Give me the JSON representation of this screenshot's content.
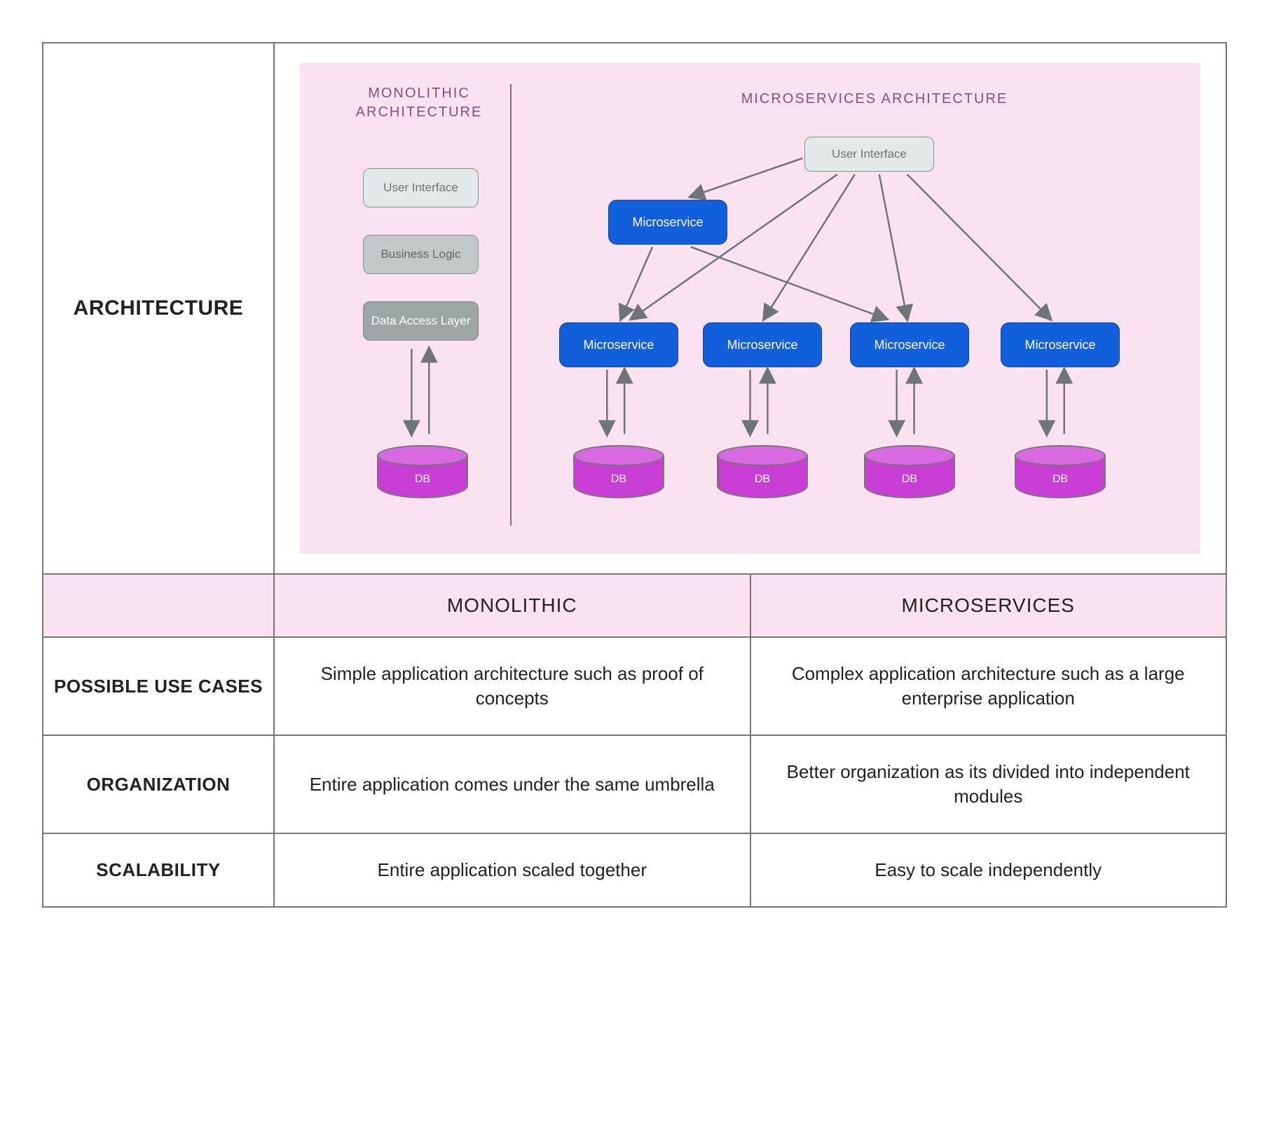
{
  "diagram": {
    "row_label_architecture": "ARCHITECTURE",
    "monolithic": {
      "title": "MONOLITHIC ARCHITECTURE",
      "ui": "User Interface",
      "bl": "Business Logic",
      "dal": "Data Access Layer",
      "db": "DB"
    },
    "microservices": {
      "title": "MICROSERVICES ARCHITECTURE",
      "ui": "User Interface",
      "ms": "Microservice",
      "db": "DB"
    }
  },
  "table": {
    "header_monolithic": "MONOLITHIC",
    "header_microservices": "MICROSERVICES",
    "rows": [
      {
        "label": "POSSIBLE USE CASES",
        "mono": "Simple application architecture such as proof of concepts",
        "micro": "Complex application architecture such as a large enterprise application"
      },
      {
        "label": "ORGANIZATION",
        "mono": "Entire application comes under the same umbrella",
        "micro": "Better organization as its divided into independent modules"
      },
      {
        "label": "SCALABILITY",
        "mono": "Entire application scaled together",
        "micro": "Easy to scale independently"
      }
    ]
  }
}
